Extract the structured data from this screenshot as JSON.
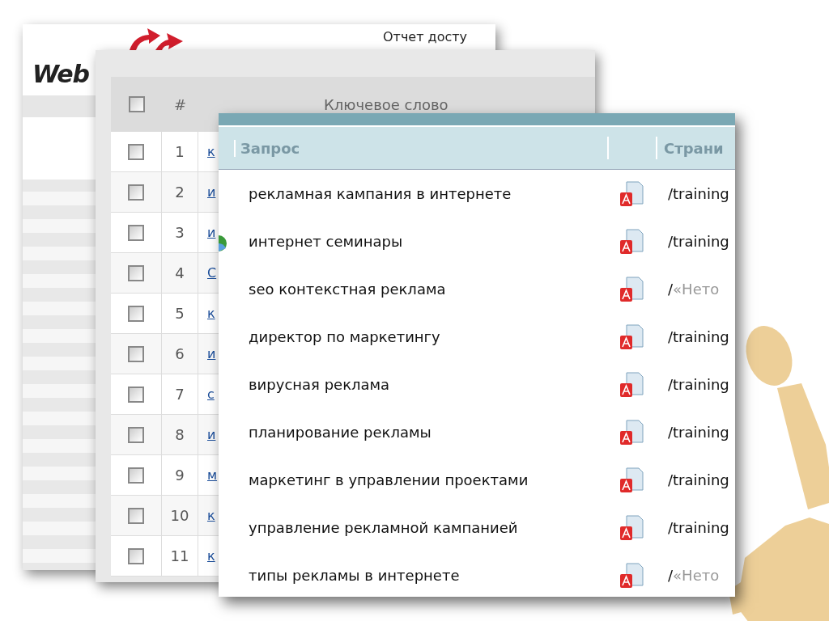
{
  "back_window": {
    "logo": "Web",
    "title": "Отчет досту"
  },
  "keywords_window": {
    "header_checked": false,
    "columns": [
      "#",
      "Ключевое слово"
    ],
    "rows": [
      {
        "num": "1",
        "keyword": "к",
        "checked": false
      },
      {
        "num": "2",
        "keyword": "и",
        "checked": false
      },
      {
        "num": "3",
        "keyword": "и",
        "checked": false
      },
      {
        "num": "4",
        "keyword": "С",
        "checked": false
      },
      {
        "num": "5",
        "keyword": "к",
        "checked": false
      },
      {
        "num": "6",
        "keyword": "и",
        "checked": false
      },
      {
        "num": "7",
        "keyword": "с",
        "checked": false
      },
      {
        "num": "8",
        "keyword": "и",
        "checked": false
      },
      {
        "num": "9",
        "keyword": "м",
        "checked": false
      },
      {
        "num": "10",
        "keyword": "к",
        "checked": false
      },
      {
        "num": "11",
        "keyword": "к",
        "checked": false
      }
    ]
  },
  "queries_window": {
    "columns": [
      "Запрос",
      "Страни"
    ],
    "rows": [
      {
        "query": "рекламная кампания в интернете",
        "path": "/training"
      },
      {
        "query": "интернет семинары",
        "path": "/training"
      },
      {
        "query": "seo контекстная реклама",
        "path": "/",
        "title": "«Нето"
      },
      {
        "query": "директор по маркетингу",
        "path": "/training"
      },
      {
        "query": "вирусная реклама",
        "path": "/training"
      },
      {
        "query": "планирование рекламы",
        "path": "/training"
      },
      {
        "query": "маркетинг в управлении проектами",
        "path": "/training"
      },
      {
        "query": "управление рекламной кампанией",
        "path": "/training"
      },
      {
        "query": "типы рекламы в интернете",
        "path": "/",
        "title": "«Нето"
      }
    ]
  }
}
